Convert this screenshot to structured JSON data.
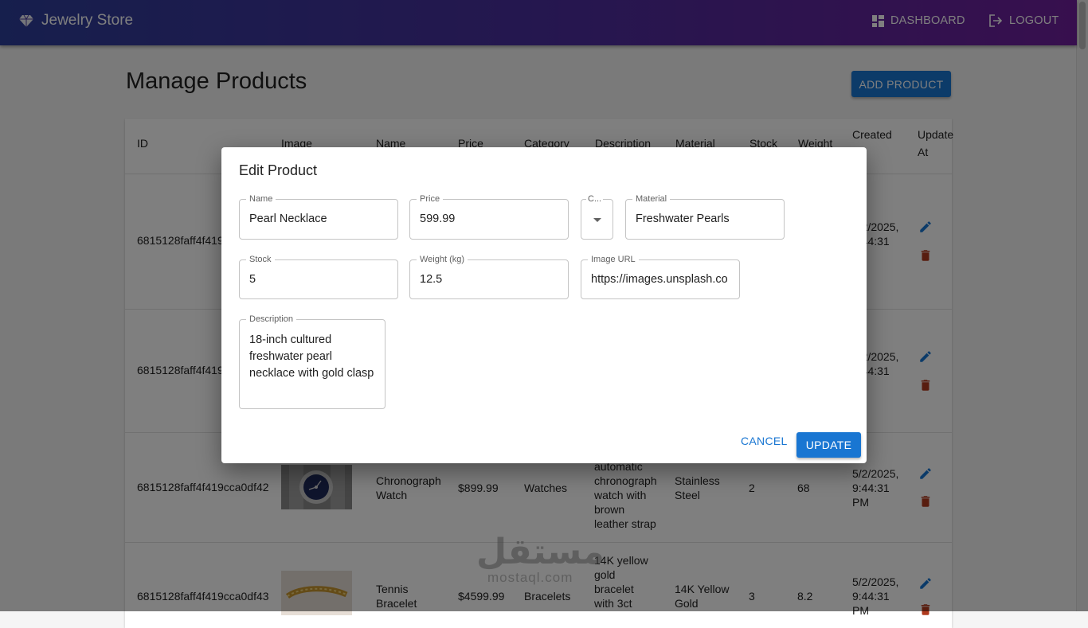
{
  "appbar": {
    "brand": "Jewelry Store",
    "dashboard_label": "DASHBOARD",
    "logout_label": "LOGOUT"
  },
  "page": {
    "title": "Manage Products",
    "add_button": "ADD PRODUCT"
  },
  "table": {
    "headers": [
      "ID",
      "Image",
      "Name",
      "Price",
      "Category",
      "Description",
      "Material",
      "Stock",
      "Weight",
      "Created",
      "Update At"
    ],
    "rows": [
      {
        "id": "6815128faff4f419c",
        "created": [
          "5/2/2025,",
          "9:44:31"
        ]
      },
      {
        "id": "6815128faff4f419c",
        "created": [
          "5/2/2025,",
          "9:44:31"
        ]
      },
      {
        "id": "6815128faff4f419cca0df42",
        "name": [
          "Chronograph",
          "Watch"
        ],
        "price": "$899.99",
        "category": "Watches",
        "description": [
          "automatic",
          "chronograph",
          "watch with",
          "brown",
          "leather strap"
        ],
        "material": [
          "Stainless",
          "Steel"
        ],
        "stock": "2",
        "weight": "68",
        "created": [
          "5/2/2025,",
          "9:44:31",
          "PM"
        ]
      },
      {
        "id": "6815128faff4f419cca0df43",
        "name": [
          "Tennis",
          "Bracelet"
        ],
        "price": "$4599.99",
        "category": "Bracelets",
        "description": [
          "14K yellow",
          "gold",
          "bracelet",
          "with 3ct"
        ],
        "material": [
          "14K Yellow",
          "Gold"
        ],
        "stock": "3",
        "weight": "8.2",
        "created": [
          "5/2/2025,",
          "9:44:31",
          "PM"
        ]
      }
    ]
  },
  "dialog": {
    "title": "Edit Product",
    "fields": {
      "name": {
        "label": "Name",
        "value": "Pearl Necklace"
      },
      "price": {
        "label": "Price",
        "value": "599.99"
      },
      "category": {
        "label": "C..."
      },
      "material": {
        "label": "Material",
        "value": "Freshwater Pearls"
      },
      "stock": {
        "label": "Stock",
        "value": "5"
      },
      "weight": {
        "label": "Weight (kg)",
        "value": "12.5"
      },
      "image_url": {
        "label": "Image URL",
        "value": "https://images.unsplash.co"
      },
      "description": {
        "label": "Description",
        "value": "18-inch cultured freshwater pearl necklace with gold clasp"
      }
    },
    "cancel_label": "CANCEL",
    "update_label": "UPDATE"
  },
  "watermark": {
    "arabic": "مستقل",
    "latin": "mostaql.com"
  },
  "colors": {
    "primary": "#1976d2",
    "delete": "#b03a1e",
    "appbar_start": "#2d3e9a",
    "appbar_end": "#6f1f9c"
  }
}
